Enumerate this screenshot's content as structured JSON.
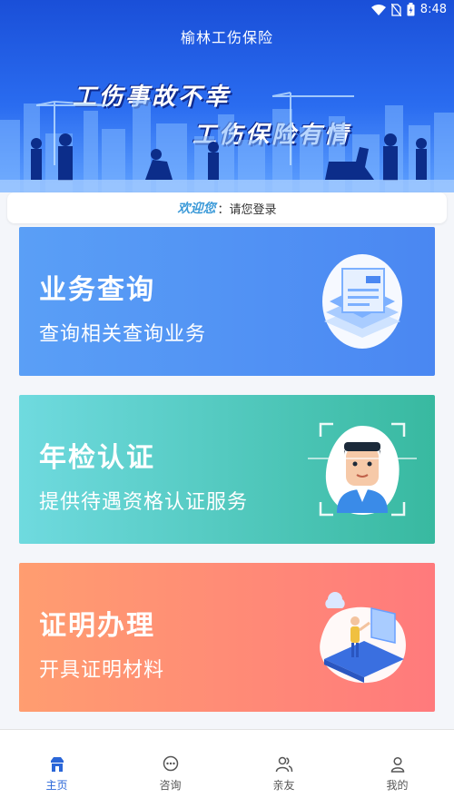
{
  "status_bar": {
    "time": "8:48"
  },
  "app_title": "榆林工伤保险",
  "banner": {
    "line1": "工伤事故不幸",
    "line2": "工伤保险有情"
  },
  "welcome": {
    "greeting": "欢迎您",
    "separator": "：",
    "message": "请您登录"
  },
  "cards": [
    {
      "title": "业务查询",
      "subtitle": "查询相关查询业务",
      "icon": "document-stack-icon",
      "color": "#4a87f2"
    },
    {
      "title": "年检认证",
      "subtitle": "提供待遇资格认证服务",
      "icon": "face-scan-icon",
      "color": "#38b9a0"
    },
    {
      "title": "证明办理",
      "subtitle": "开具证明材料",
      "icon": "presenter-icon",
      "color": "#ff7a7c"
    }
  ],
  "bottom_nav": [
    {
      "label": "主页",
      "icon": "home-icon",
      "active": true
    },
    {
      "label": "咨询",
      "icon": "chat-icon",
      "active": false
    },
    {
      "label": "亲友",
      "icon": "friends-icon",
      "active": false
    },
    {
      "label": "我的",
      "icon": "user-icon",
      "active": false
    }
  ],
  "colors": {
    "nav_active": "#2a66d8",
    "nav_inactive": "#555555",
    "header_blue": "#1a4fd8"
  }
}
